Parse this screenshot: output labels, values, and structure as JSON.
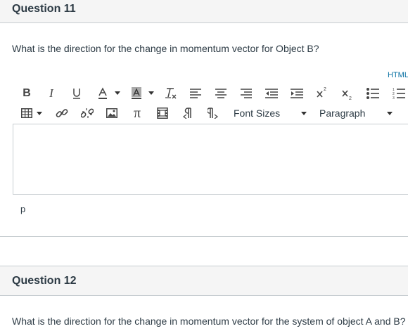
{
  "question11": {
    "title": "Question 11",
    "text": "What is the direction for the change in momentum vector for Object B?"
  },
  "editor": {
    "html_link": "HTML",
    "font_sizes_label": "Font Sizes",
    "paragraph_label": "Paragraph",
    "content": "",
    "path_indicator": "p",
    "toolbar_icons": [
      "bold-icon",
      "italic-icon",
      "underline-icon",
      "text-color-icon",
      "background-color-icon",
      "clear-formatting-icon",
      "align-left-icon",
      "align-center-icon",
      "align-right-icon",
      "outdent-icon",
      "indent-icon",
      "superscript-icon",
      "subscript-icon",
      "bullet-list-icon",
      "numbered-list-icon",
      "table-icon",
      "link-icon",
      "unlink-icon",
      "image-icon",
      "math-icon",
      "media-icon",
      "ltr-icon",
      "rtl-icon"
    ]
  },
  "question12": {
    "title": "Question 12",
    "text": "What is the direction for the change in momentum vector for the system of object A and B?"
  },
  "colors": {
    "header_bg": "#f5f5f5",
    "border": "#c7cdd1",
    "link": "#0770a3",
    "text": "#2d3b45"
  }
}
